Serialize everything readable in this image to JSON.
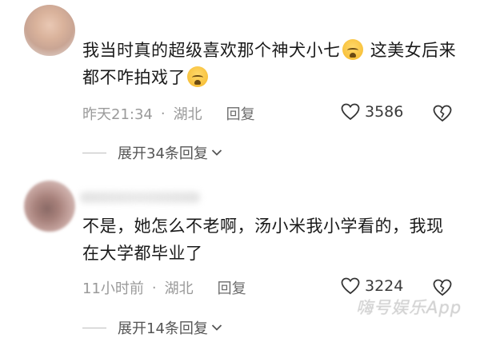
{
  "comments": [
    {
      "text_part1": "我当时真的超级喜欢那个神犬小七",
      "text_part2": "这美女后来都不咋拍戏了",
      "emoji": "crying-face",
      "time": "昨天21:34",
      "dot": "·",
      "location": "湖北",
      "reply_label": "回复",
      "likes": "3586",
      "expand_label": "展开34条回复"
    },
    {
      "text": "不是，她怎么不老啊，汤小米我小学看的，我现在大学都毕业了",
      "time": "11小时前",
      "dot": "·",
      "location": "湖北",
      "reply_label": "回复",
      "likes": "3224",
      "expand_label": "展开14条回复"
    }
  ],
  "watermark": "嗨号娱乐App",
  "colors": {
    "meta": "#9a9a9a",
    "text": "#1a1a1a",
    "emoji": "#f5b829"
  }
}
